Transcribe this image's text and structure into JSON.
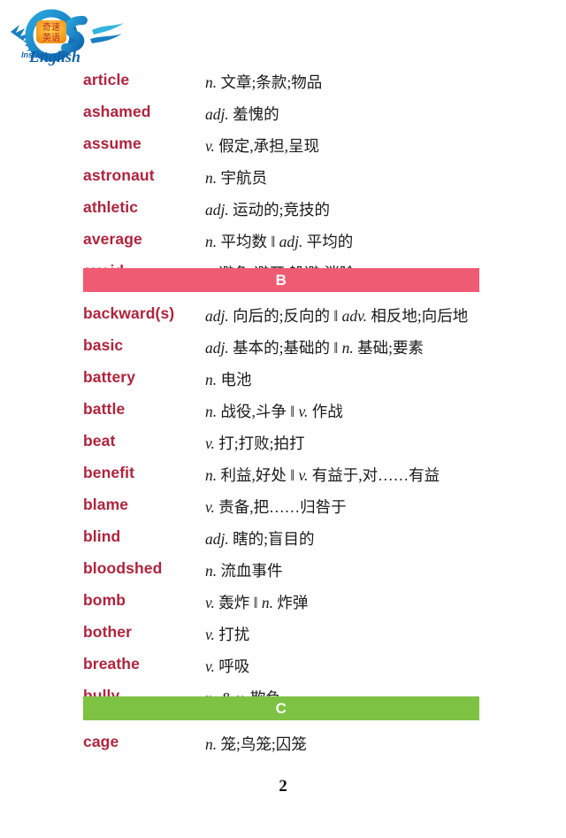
{
  "logo": {
    "brand_latin": "English",
    "brand_prefix": "Instant",
    "brand_mark": "QS",
    "brand_badge_chinese": "奇速英语",
    "colors": {
      "logo_blue": "#1a7fc1",
      "logo_cyan": "#35b3e0",
      "badge_orange": "#f2a01e",
      "badge_text_red": "#c0272d"
    }
  },
  "colors": {
    "word_red": "#b2233c",
    "section_b_bar": "#ef5b72",
    "section_c_bar": "#7dc242",
    "text_black": "#1a1a1a"
  },
  "page_number": "2",
  "sections": [
    {
      "letter": "",
      "bar_color": "",
      "entries": [
        {
          "word": "article",
          "definition": "n. 文章;条款;物品"
        },
        {
          "word": "ashamed",
          "definition": "adj. 羞愧的"
        },
        {
          "word": "assume",
          "definition": "v. 假定,承担,呈现"
        },
        {
          "word": "astronaut",
          "definition": "n. 宇航员"
        },
        {
          "word": "athletic",
          "definition": "adj. 运动的;竞技的"
        },
        {
          "word": "average",
          "definition": "n. 平均数 ‖ adj. 平均的"
        },
        {
          "word": "avoid",
          "definition": "v. 避免;避开,躲避;消除"
        }
      ]
    },
    {
      "letter": "B",
      "bar_color": "#ef5b72",
      "entries": [
        {
          "word": "backward(s)",
          "definition": "adj. 向后的;反向的 ‖ adv. 相反地;向后地"
        },
        {
          "word": "basic",
          "definition": "adj. 基本的;基础的 ‖ n. 基础;要素"
        },
        {
          "word": "battery",
          "definition": "n. 电池"
        },
        {
          "word": "battle",
          "definition": "n. 战役,斗争 ‖ v. 作战"
        },
        {
          "word": "beat",
          "definition": "v. 打;打败;拍打"
        },
        {
          "word": "benefit",
          "definition": "n. 利益,好处 ‖ v. 有益于,对……有益"
        },
        {
          "word": "blame",
          "definition": "v. 责备,把……归咎于"
        },
        {
          "word": "blind",
          "definition": "adj. 瞎的;盲目的"
        },
        {
          "word": "bloodshed",
          "definition": "n. 流血事件"
        },
        {
          "word": "bomb",
          "definition": "v. 轰炸 ‖ n. 炸弹"
        },
        {
          "word": "bother",
          "definition": "v. 打扰"
        },
        {
          "word": "breathe",
          "definition": "v. 呼吸"
        },
        {
          "word": "bully",
          "definition": "n. & v. 欺负"
        }
      ]
    },
    {
      "letter": "C",
      "bar_color": "#7dc242",
      "entries": [
        {
          "word": "cage",
          "definition": "n. 笼;鸟笼;囚笼"
        }
      ]
    }
  ]
}
